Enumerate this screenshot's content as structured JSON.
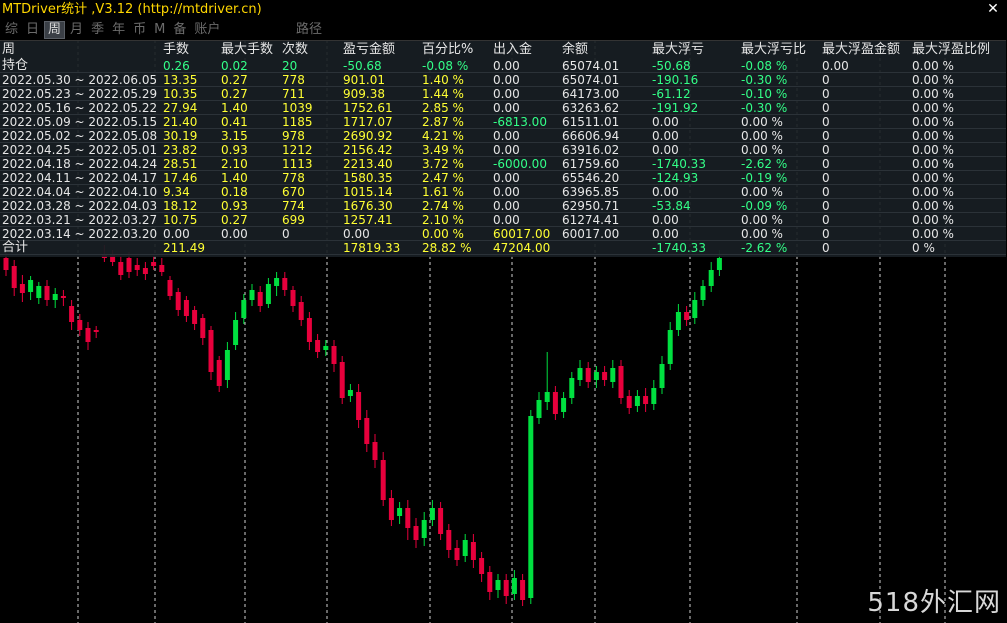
{
  "window": {
    "title": "MTDriver统计 ,V3.12 (http://mtdriver.cn)",
    "close_label": "✕"
  },
  "tabs": [
    {
      "label": "综",
      "active": false
    },
    {
      "label": "日",
      "active": false
    },
    {
      "label": "周",
      "active": true
    },
    {
      "label": "月",
      "active": false
    },
    {
      "label": "季",
      "active": false
    },
    {
      "label": "年",
      "active": false
    },
    {
      "label": "币",
      "active": false
    },
    {
      "label": "M",
      "active": false
    },
    {
      "label": "备",
      "active": false
    },
    {
      "label": "账户",
      "active": false
    }
  ],
  "path_tab": "路径",
  "table": {
    "headers": [
      "周",
      "手数",
      "最大手数",
      "次数",
      "盈亏金额",
      "百分比%",
      "出入金",
      "余额",
      "最大浮亏",
      "最大浮亏比",
      "最大浮盈金额",
      "最大浮盈比例"
    ],
    "rows": [
      {
        "cells": [
          "持仓",
          "0.26",
          "0.02",
          "20",
          "-50.68",
          "-0.08 %",
          "0.00",
          "65074.01",
          "-50.68",
          "-0.08 %",
          "0.00",
          "0.00 %"
        ],
        "colors": [
          "w",
          "g",
          "g",
          "g",
          "g",
          "g",
          "w",
          "w",
          "g",
          "g",
          "w",
          "w"
        ]
      },
      {
        "cells": [
          "2022.05.30 ~ 2022.06.05",
          "13.35",
          "0.27",
          "778",
          "901.01",
          "1.40 %",
          "0.00",
          "65074.01",
          "-190.16",
          "-0.30 %",
          "0",
          "0.00 %"
        ],
        "colors": [
          "w",
          "y",
          "y",
          "y",
          "y",
          "y",
          "w",
          "w",
          "g",
          "g",
          "w",
          "w"
        ]
      },
      {
        "cells": [
          "2022.05.23 ~ 2022.05.29",
          "10.35",
          "0.27",
          "711",
          "909.38",
          "1.44 %",
          "0.00",
          "64173.00",
          "-61.12",
          "-0.10 %",
          "0",
          "0.00 %"
        ],
        "colors": [
          "w",
          "y",
          "y",
          "y",
          "y",
          "y",
          "w",
          "w",
          "g",
          "g",
          "w",
          "w"
        ]
      },
      {
        "cells": [
          "2022.05.16 ~ 2022.05.22",
          "27.94",
          "1.40",
          "1039",
          "1752.61",
          "2.85 %",
          "0.00",
          "63263.62",
          "-191.92",
          "-0.30 %",
          "0",
          "0.00 %"
        ],
        "colors": [
          "w",
          "y",
          "y",
          "y",
          "y",
          "y",
          "w",
          "w",
          "g",
          "g",
          "w",
          "w"
        ]
      },
      {
        "cells": [
          "2022.05.09 ~ 2022.05.15",
          "21.40",
          "0.41",
          "1185",
          "1717.07",
          "2.87 %",
          "-6813.00",
          "61511.01",
          "0.00",
          "0.00 %",
          "0",
          "0.00 %"
        ],
        "colors": [
          "w",
          "y",
          "y",
          "y",
          "y",
          "y",
          "g",
          "w",
          "w",
          "w",
          "w",
          "w"
        ]
      },
      {
        "cells": [
          "2022.05.02 ~ 2022.05.08",
          "30.19",
          "3.15",
          "978",
          "2690.92",
          "4.21 %",
          "0.00",
          "66606.94",
          "0.00",
          "0.00 %",
          "0",
          "0.00 %"
        ],
        "colors": [
          "w",
          "y",
          "y",
          "y",
          "y",
          "y",
          "w",
          "w",
          "w",
          "w",
          "w",
          "w"
        ]
      },
      {
        "cells": [
          "2022.04.25 ~ 2022.05.01",
          "23.82",
          "0.93",
          "1212",
          "2156.42",
          "3.49 %",
          "0.00",
          "63916.02",
          "0.00",
          "0.00 %",
          "0",
          "0.00 %"
        ],
        "colors": [
          "w",
          "y",
          "y",
          "y",
          "y",
          "y",
          "w",
          "w",
          "w",
          "w",
          "w",
          "w"
        ]
      },
      {
        "cells": [
          "2022.04.18 ~ 2022.04.24",
          "28.51",
          "2.10",
          "1113",
          "2213.40",
          "3.72 %",
          "-6000.00",
          "61759.60",
          "-1740.33",
          "-2.62 %",
          "0",
          "0.00 %"
        ],
        "colors": [
          "w",
          "y",
          "y",
          "y",
          "y",
          "y",
          "g",
          "w",
          "g",
          "g",
          "w",
          "w"
        ]
      },
      {
        "cells": [
          "2022.04.11 ~ 2022.04.17",
          "17.46",
          "1.40",
          "778",
          "1580.35",
          "2.47 %",
          "0.00",
          "65546.20",
          "-124.93",
          "-0.19 %",
          "0",
          "0.00 %"
        ],
        "colors": [
          "w",
          "y",
          "y",
          "y",
          "y",
          "y",
          "w",
          "w",
          "g",
          "g",
          "w",
          "w"
        ]
      },
      {
        "cells": [
          "2022.04.04 ~ 2022.04.10",
          "9.34",
          "0.18",
          "670",
          "1015.14",
          "1.61 %",
          "0.00",
          "63965.85",
          "0.00",
          "0.00 %",
          "0",
          "0.00 %"
        ],
        "colors": [
          "w",
          "y",
          "y",
          "y",
          "y",
          "y",
          "w",
          "w",
          "w",
          "w",
          "w",
          "w"
        ]
      },
      {
        "cells": [
          "2022.03.28 ~ 2022.04.03",
          "18.12",
          "0.93",
          "774",
          "1676.30",
          "2.74 %",
          "0.00",
          "62950.71",
          "-53.84",
          "-0.09 %",
          "0",
          "0.00 %"
        ],
        "colors": [
          "w",
          "y",
          "y",
          "y",
          "y",
          "y",
          "w",
          "w",
          "g",
          "g",
          "w",
          "w"
        ]
      },
      {
        "cells": [
          "2022.03.21 ~ 2022.03.27",
          "10.75",
          "0.27",
          "699",
          "1257.41",
          "2.10 %",
          "0.00",
          "61274.41",
          "0.00",
          "0.00 %",
          "0",
          "0.00 %"
        ],
        "colors": [
          "w",
          "y",
          "y",
          "y",
          "y",
          "y",
          "w",
          "w",
          "w",
          "w",
          "w",
          "w"
        ]
      },
      {
        "cells": [
          "2022.03.14 ~ 2022.03.20",
          "0.00",
          "0.00",
          "0",
          "0.00",
          "0.00 %",
          "60017.00",
          "60017.00",
          "0.00",
          "0.00 %",
          "0",
          "0.00 %"
        ],
        "colors": [
          "w",
          "w",
          "w",
          "w",
          "w",
          "y",
          "y",
          "w",
          "w",
          "w",
          "w",
          "w"
        ]
      },
      {
        "cells": [
          "合计",
          "211.49",
          "",
          "",
          "17819.33",
          "28.82 %",
          "47204.00",
          "",
          "-1740.33",
          "-2.62 %",
          "0",
          "0 %"
        ],
        "colors": [
          "w",
          "y",
          "y",
          "y",
          "y",
          "y",
          "y",
          "w",
          "g",
          "g",
          "w",
          "w"
        ]
      }
    ]
  },
  "colors": {
    "white": "#e6e6e6",
    "yellow": "#FFFF33",
    "green": "#33FF88",
    "bull": "#00e040",
    "bear": "#e8003c",
    "grid": "#cfcfcf"
  },
  "watermark": "518外汇网",
  "chart_data": {
    "type": "candlestick",
    "candles": [
      [
        258,
        270,
        253,
        276
      ],
      [
        266,
        288,
        260,
        296
      ],
      [
        284,
        293,
        275,
        302
      ],
      [
        292,
        280,
        276,
        300
      ],
      [
        298,
        286,
        282,
        304
      ],
      [
        286,
        300,
        280,
        306
      ],
      [
        300,
        294,
        288,
        308
      ],
      [
        296,
        298,
        290,
        306
      ],
      [
        306,
        322,
        300,
        330
      ],
      [
        320,
        330,
        314,
        336
      ],
      [
        328,
        342,
        322,
        350
      ],
      [
        330,
        332,
        326,
        338
      ],
      [
        255,
        258,
        245,
        262
      ],
      [
        255,
        262,
        250,
        266
      ],
      [
        262,
        275,
        256,
        280
      ],
      [
        258,
        272,
        252,
        278
      ],
      [
        265,
        270,
        258,
        276
      ],
      [
        268,
        274,
        262,
        280
      ],
      [
        262,
        266,
        256,
        270
      ],
      [
        265,
        272,
        258,
        276
      ],
      [
        280,
        296,
        276,
        300
      ],
      [
        292,
        310,
        288,
        316
      ],
      [
        300,
        316,
        296,
        322
      ],
      [
        310,
        324,
        306,
        330
      ],
      [
        318,
        338,
        314,
        345
      ],
      [
        330,
        372,
        326,
        380
      ],
      [
        360,
        386,
        356,
        392
      ],
      [
        380,
        350,
        342,
        388
      ],
      [
        345,
        320,
        312,
        350
      ],
      [
        318,
        300,
        294,
        324
      ],
      [
        300,
        290,
        284,
        306
      ],
      [
        292,
        306,
        286,
        312
      ],
      [
        304,
        284,
        278,
        308
      ],
      [
        286,
        278,
        272,
        296
      ],
      [
        278,
        290,
        272,
        296
      ],
      [
        290,
        306,
        286,
        312
      ],
      [
        302,
        320,
        296,
        326
      ],
      [
        318,
        342,
        312,
        350
      ],
      [
        340,
        352,
        334,
        358
      ],
      [
        350,
        346,
        340,
        356
      ],
      [
        346,
        364,
        340,
        372
      ],
      [
        362,
        398,
        356,
        404
      ],
      [
        396,
        390,
        384,
        402
      ],
      [
        392,
        420,
        384,
        428
      ],
      [
        418,
        444,
        410,
        452
      ],
      [
        442,
        460,
        434,
        468
      ],
      [
        460,
        500,
        452,
        506
      ],
      [
        498,
        520,
        490,
        526
      ],
      [
        516,
        508,
        502,
        524
      ],
      [
        508,
        528,
        500,
        540
      ],
      [
        526,
        540,
        518,
        548
      ],
      [
        538,
        520,
        512,
        546
      ],
      [
        520,
        508,
        500,
        526
      ],
      [
        508,
        534,
        502,
        540
      ],
      [
        530,
        550,
        524,
        558
      ],
      [
        548,
        560,
        540,
        566
      ],
      [
        556,
        540,
        534,
        562
      ],
      [
        542,
        560,
        534,
        568
      ],
      [
        558,
        574,
        552,
        582
      ],
      [
        572,
        592,
        566,
        600
      ],
      [
        590,
        580,
        574,
        598
      ],
      [
        580,
        596,
        574,
        604
      ],
      [
        594,
        578,
        570,
        600
      ],
      [
        580,
        600,
        574,
        606
      ],
      [
        598,
        416,
        410,
        604
      ],
      [
        418,
        400,
        392,
        424
      ],
      [
        402,
        392,
        352,
        410
      ],
      [
        392,
        414,
        386,
        420
      ],
      [
        412,
        398,
        392,
        418
      ],
      [
        398,
        378,
        372,
        404
      ],
      [
        380,
        368,
        360,
        386
      ],
      [
        368,
        382,
        362,
        388
      ],
      [
        380,
        372,
        366,
        388
      ],
      [
        372,
        380,
        366,
        386
      ],
      [
        382,
        368,
        360,
        388
      ],
      [
        366,
        398,
        360,
        404
      ],
      [
        396,
        408,
        390,
        414
      ],
      [
        406,
        396,
        390,
        412
      ],
      [
        396,
        404,
        388,
        412
      ],
      [
        404,
        388,
        380,
        410
      ],
      [
        388,
        364,
        356,
        394
      ],
      [
        364,
        330,
        322,
        370
      ],
      [
        330,
        312,
        304,
        336
      ],
      [
        312,
        320,
        306,
        326
      ],
      [
        318,
        300,
        292,
        324
      ],
      [
        300,
        286,
        280,
        306
      ],
      [
        286,
        270,
        262,
        292
      ],
      [
        270,
        258,
        250,
        276
      ]
    ]
  }
}
